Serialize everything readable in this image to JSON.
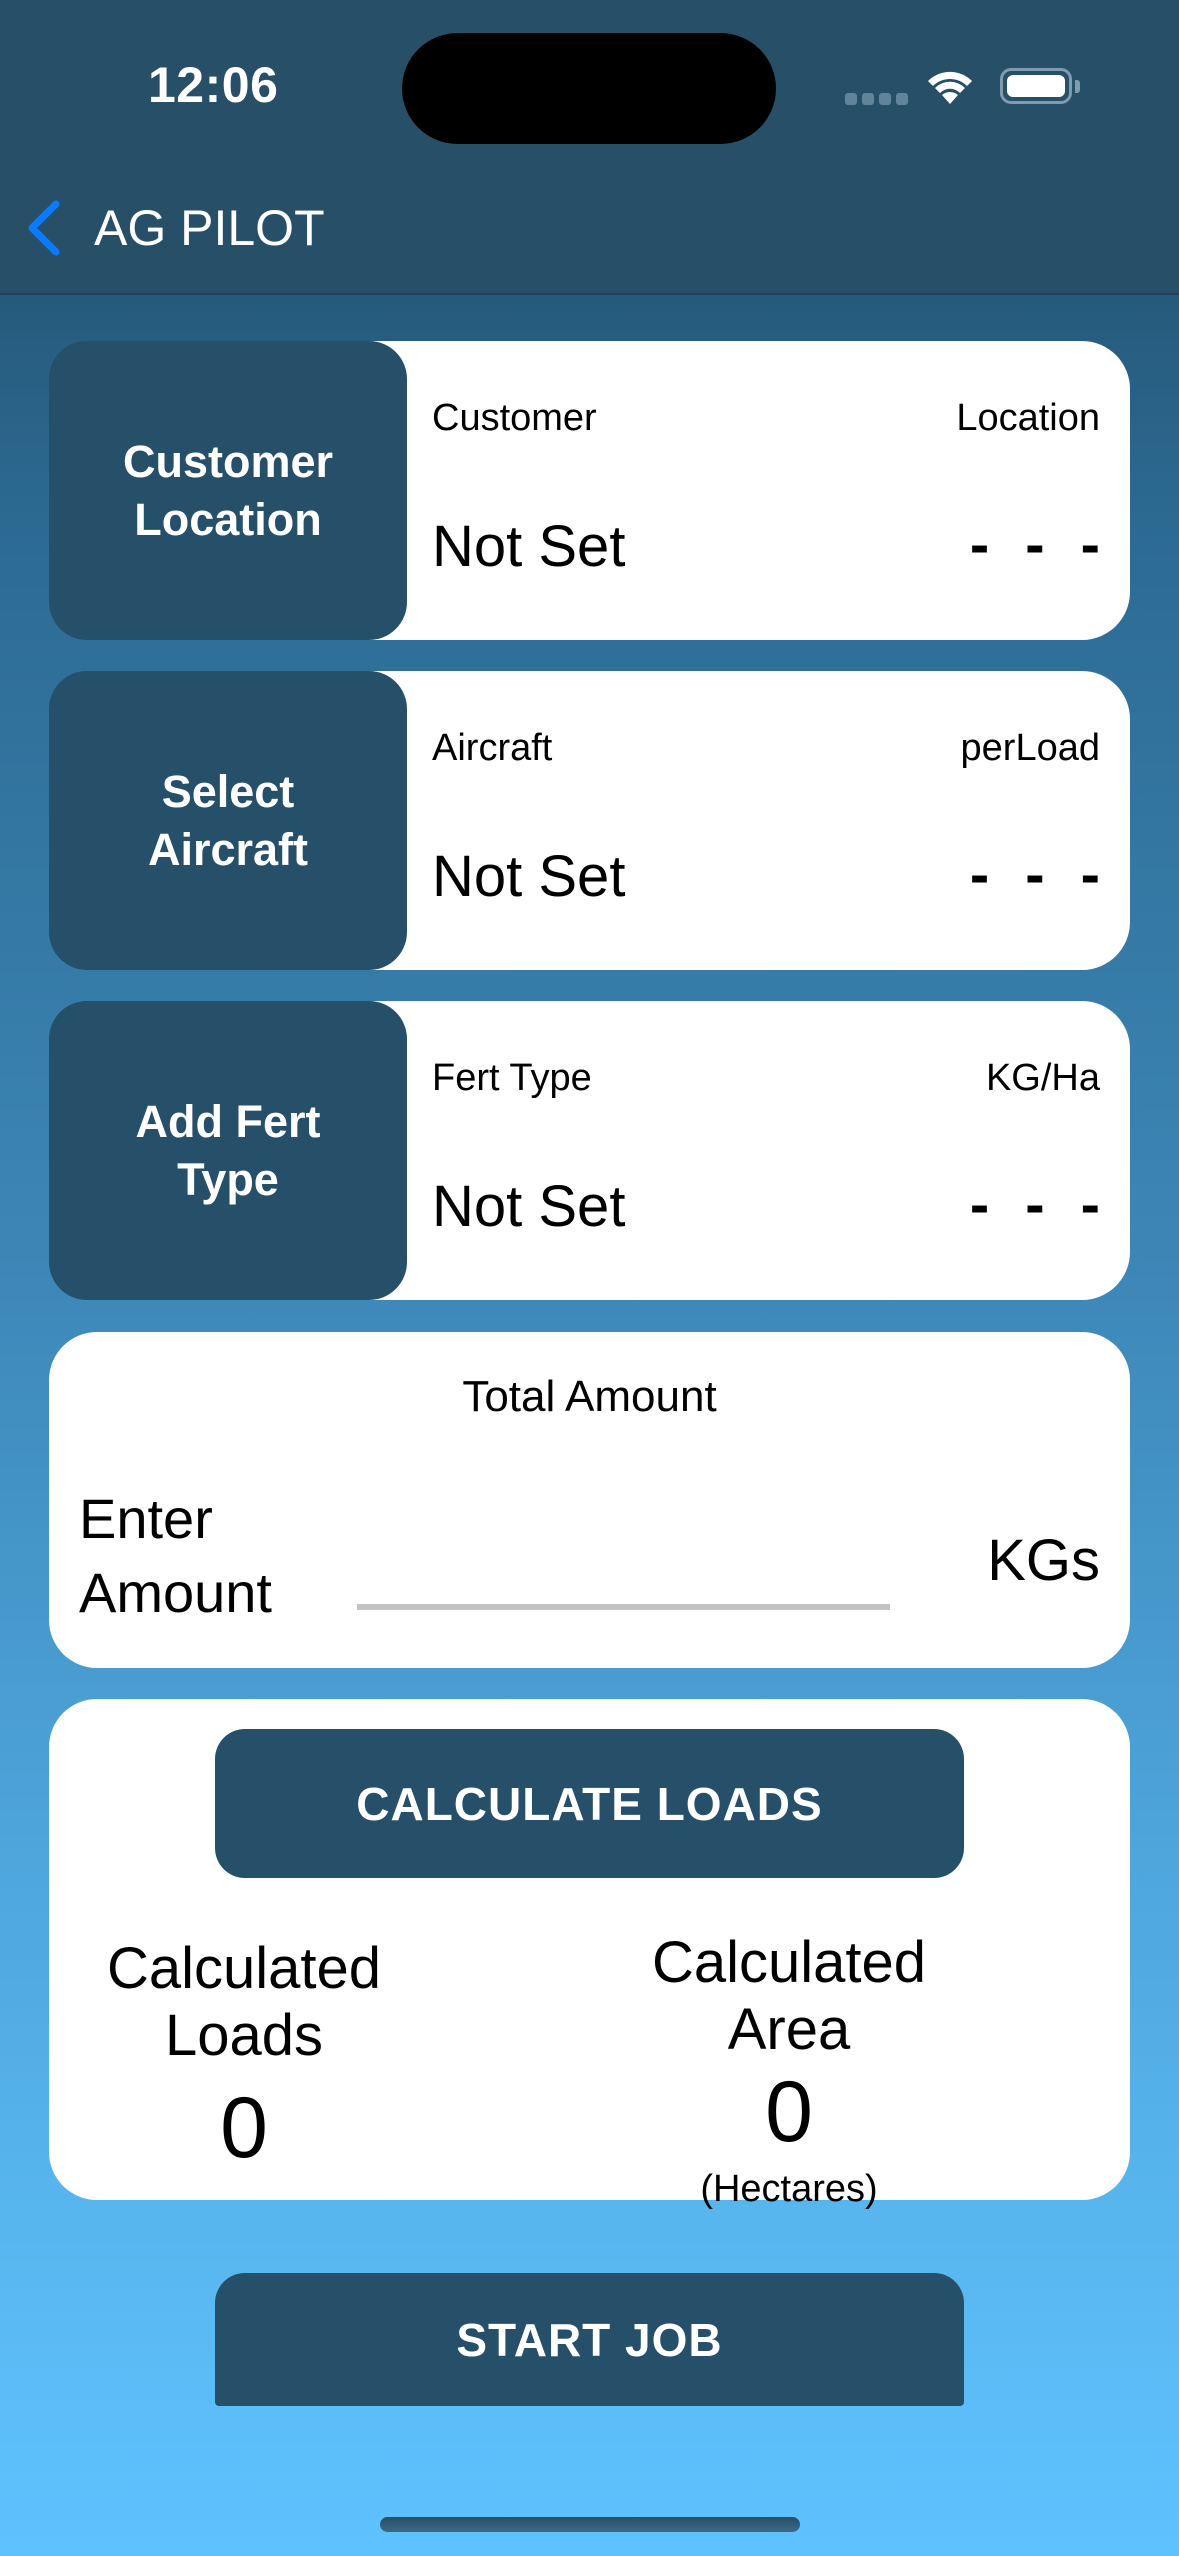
{
  "status_bar": {
    "time": "12:06",
    "icons": [
      "cellular-signal-icon",
      "wifi-icon",
      "battery-icon"
    ]
  },
  "nav": {
    "back_icon": "chevron-left-icon",
    "back_label": "AG PILOT"
  },
  "colors": {
    "nav_bg": "#275068",
    "button_bg": "#264f69",
    "back_chevron": "#0a7aff",
    "input_underline": "#c4c4c4",
    "bg_top": "#2c6a92",
    "bg_bottom": "#5ec2ff"
  },
  "customer_card": {
    "button_label": "Customer\nLocation",
    "left_label": "Customer",
    "right_label": "Location",
    "left_value": "Not Set",
    "right_value": "- - -"
  },
  "aircraft_card": {
    "button_label": "Select\nAircraft",
    "left_label": "Aircraft",
    "right_label": "perLoad",
    "left_value": "Not Set",
    "right_value": "- - -"
  },
  "fert_card": {
    "button_label": "Add Fert\nType",
    "left_label": "Fert Type",
    "right_label": "KG/Ha",
    "left_value": "Not Set",
    "right_value": "- - -"
  },
  "total_amount": {
    "title": "Total Amount",
    "field_label": "Enter\nAmount",
    "value": "",
    "placeholder": "",
    "unit": "KGs"
  },
  "results": {
    "calculate_button": "CALCULATE LOADS",
    "loads_label": "Calculated Loads",
    "loads_value": "0",
    "area_label": "Calculated Area",
    "area_value": "0",
    "area_unit": "(Hectares)"
  },
  "start_job_button": "START JOB"
}
